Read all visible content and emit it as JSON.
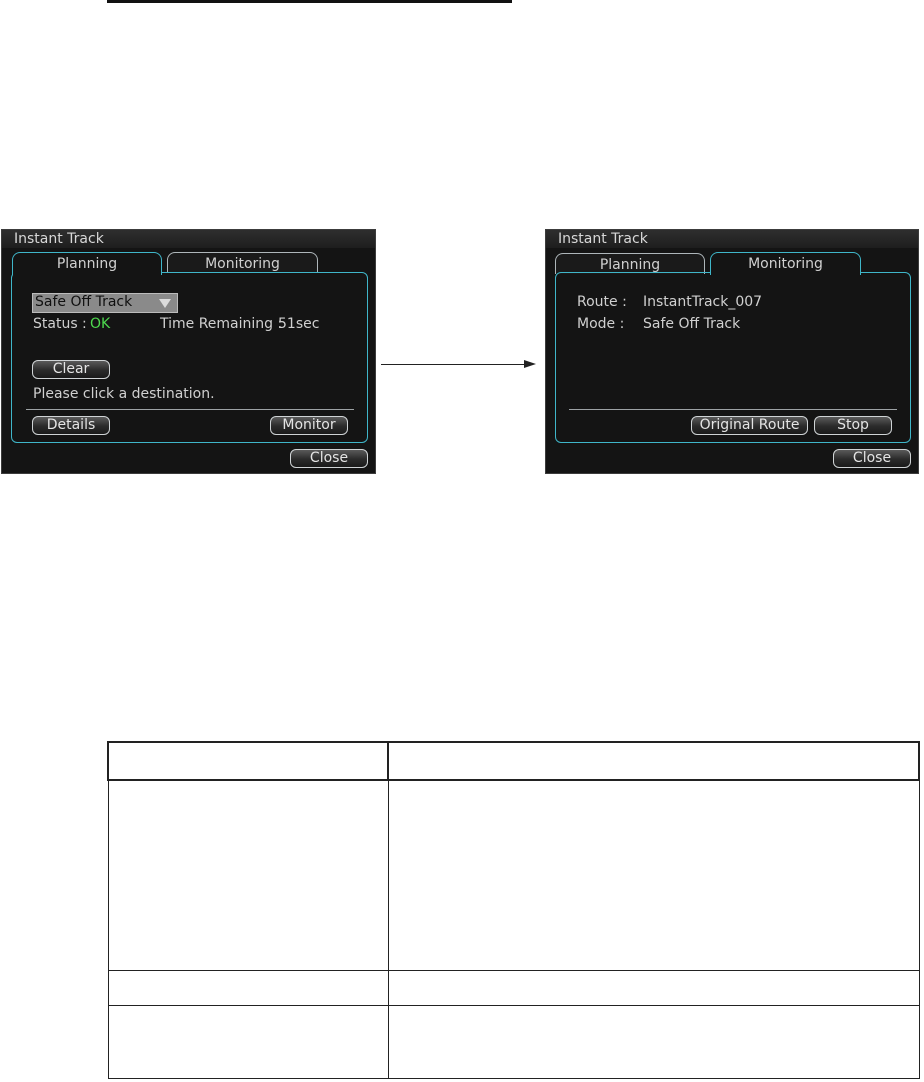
{
  "left_dialog": {
    "title": "Instant Track",
    "tabs": [
      {
        "label": "Planning"
      },
      {
        "label": "Monitoring"
      }
    ],
    "mode_select": "Safe Off Track",
    "status_label": "Status :",
    "status_value": "OK",
    "time_label": "Time Remaining :",
    "time_value": "51sec",
    "clear_button": "Clear",
    "hint": "Please click a destination.",
    "details_button": "Details",
    "monitor_button": "Monitor",
    "close_button": "Close"
  },
  "right_dialog": {
    "title": "Instant Track",
    "tabs": [
      {
        "label": "Planning"
      },
      {
        "label": "Monitoring"
      }
    ],
    "route_label": "Route :",
    "route_value": "InstantTrack_007",
    "mode_label": "Mode :",
    "mode_value": "Safe Off Track",
    "original_route_button": "Original Route",
    "stop_button": "Stop",
    "close_button": "Close"
  },
  "colors": {
    "frame": "#3fb6c9",
    "ok": "#4ed84e",
    "panel": "#141414"
  }
}
